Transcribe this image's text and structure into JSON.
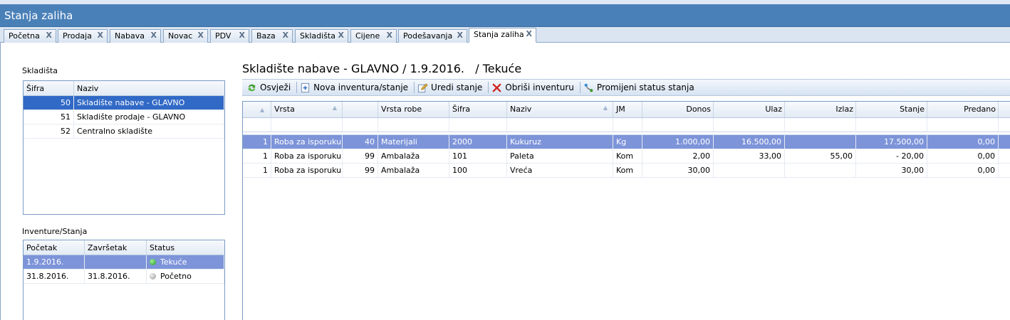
{
  "window": {
    "title": "Stanja zaliha"
  },
  "tabs": [
    {
      "label": "Početna"
    },
    {
      "label": "Prodaja"
    },
    {
      "label": "Nabava"
    },
    {
      "label": "Novac"
    },
    {
      "label": "PDV"
    },
    {
      "label": "Baza"
    },
    {
      "label": "Skladišta"
    },
    {
      "label": "Cijene"
    },
    {
      "label": "Podešavanja"
    },
    {
      "label": "Stanja zaliha"
    }
  ],
  "tab_close": "X",
  "warehouses": {
    "label": "Skladišta",
    "columns": [
      "Šifra",
      "Naziv"
    ],
    "rows": [
      {
        "sifra": "50",
        "naziv": "Skladište nabave - GLAVNO"
      },
      {
        "sifra": "51",
        "naziv": "Skladište prodaje - GLAVNO"
      },
      {
        "sifra": "52",
        "naziv": "Centralno skladište"
      }
    ]
  },
  "inventories": {
    "label": "Inventure/Stanja",
    "columns": [
      "Početak",
      "Završetak",
      "Status"
    ],
    "rows": [
      {
        "pocetak": "1.9.2016.",
        "zavrsetak": "",
        "status": "Tekuće"
      },
      {
        "pocetak": "31.8.2016.",
        "zavrsetak": "31.8.2016.",
        "status": "Početno"
      }
    ]
  },
  "main": {
    "title": "Skladište nabave - GLAVNO / 1.9.2016.   / Tekuće",
    "toolbar": {
      "refresh": "Osvježi",
      "new_inventory": "Nova inventura/stanje",
      "edit": "Uredi stanje",
      "delete": "Obriši inventuru",
      "change_status": "Promijeni status stanja"
    },
    "columns": [
      "Vrsta",
      "Vrsta robe",
      "Šifra",
      "Naziv",
      "JM",
      "Donos",
      "Ulaz",
      "Izlaz",
      "Stanje",
      "Predano"
    ],
    "rows": [
      {
        "vrsta_no": "1",
        "vrsta": "Roba za isporuku",
        "vrsta_robe_no": "40",
        "vrsta_robe": "Materijali",
        "sifra": "2000",
        "naziv": "Kukuruz",
        "jm": "Kg",
        "donos": "1.000,00",
        "ulaz": "16.500,00",
        "izlaz": "",
        "stanje": "17.500,00",
        "predano": "0,00"
      },
      {
        "vrsta_no": "1",
        "vrsta": "Roba za isporuku",
        "vrsta_robe_no": "99",
        "vrsta_robe": "Ambalaža",
        "sifra": "101",
        "naziv": "Paleta",
        "jm": "Kom",
        "donos": "2,00",
        "ulaz": "33,00",
        "izlaz": "55,00",
        "stanje": "- 20,00",
        "predano": "0,00"
      },
      {
        "vrsta_no": "1",
        "vrsta": "Roba za isporuku",
        "vrsta_robe_no": "99",
        "vrsta_robe": "Ambalaža",
        "sifra": "100",
        "naziv": "Vreća",
        "jm": "Kom",
        "donos": "30,00",
        "ulaz": "",
        "izlaz": "",
        "stanje": "30,00",
        "predano": "0,00"
      }
    ]
  },
  "colors": {
    "title_bar": "#4a80b8",
    "selection_dark": "#3169c6",
    "selection_light": "#7d94d9",
    "status_active": "#1e9a1e",
    "status_inactive": "#9a9a9a",
    "delete_icon": "#d0201b"
  }
}
